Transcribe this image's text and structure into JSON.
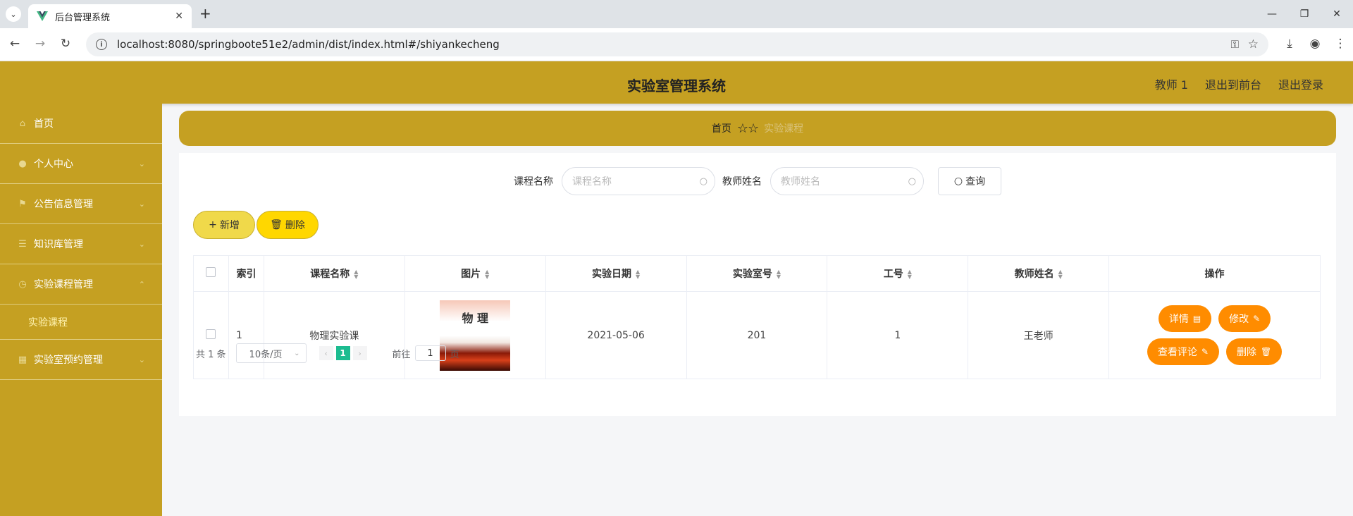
{
  "browser": {
    "tab_title": "后台管理系统",
    "url": "localhost:8080/springboote51e2/admin/dist/index.html#/shiyankecheng"
  },
  "header": {
    "title": "实验室管理系统",
    "user": "教师 1",
    "to_front": "退出到前台",
    "logout": "退出登录"
  },
  "sidebar": {
    "items": [
      {
        "label": "首页"
      },
      {
        "label": "个人中心"
      },
      {
        "label": "公告信息管理"
      },
      {
        "label": "知识库管理"
      },
      {
        "label": "实验课程管理"
      },
      {
        "label": "实验室预约管理"
      }
    ],
    "sub_active": "实验课程"
  },
  "breadcrumb": {
    "home": "首页",
    "current": "实验课程"
  },
  "search": {
    "course_label": "课程名称",
    "course_placeholder": "课程名称",
    "teacher_label": "教师姓名",
    "teacher_placeholder": "教师姓名",
    "query_label": "查询"
  },
  "toolbar": {
    "add_label": "新增",
    "delete_label": "删除"
  },
  "table": {
    "headers": [
      "索引",
      "课程名称",
      "图片",
      "实验日期",
      "实验室号",
      "工号",
      "教师姓名",
      "操作"
    ],
    "rows": [
      {
        "index": "1",
        "course": "物理实验课",
        "image_text": "物 理",
        "date": "2021-05-06",
        "room": "201",
        "job_no": "1",
        "teacher": "王老师"
      }
    ],
    "actions": {
      "detail": "详情",
      "edit": "修改",
      "comments": "查看评论",
      "delete": "删除"
    }
  },
  "pager": {
    "total": "共 1 条",
    "size": "10条/页",
    "current_page": "1",
    "goto_label": "前往",
    "goto_value": "1",
    "page_suffix": "页"
  },
  "colors": {
    "theme": "#c5a022",
    "action_orange": "#ff8c00",
    "pager_active": "#1cbc90"
  }
}
